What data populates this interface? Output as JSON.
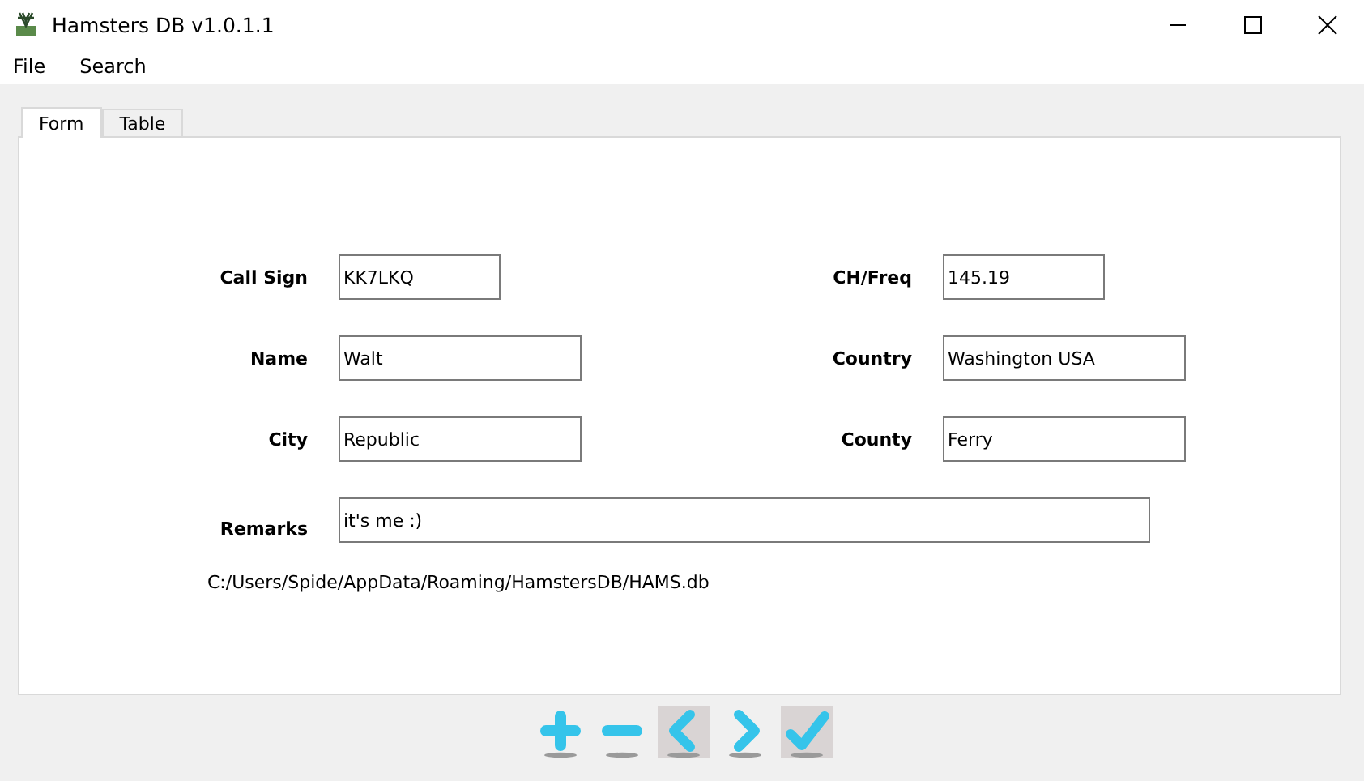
{
  "window": {
    "title": "Hamsters DB v1.0.1.1"
  },
  "menu": [
    "File",
    "Search"
  ],
  "tabs": [
    {
      "label": "Form",
      "selected": true
    },
    {
      "label": "Table",
      "selected": false
    }
  ],
  "fields": [
    {
      "label": "Call Sign",
      "value": "KK7LKQ",
      "kind": "short"
    },
    {
      "label": "CH/Freq",
      "value": "145.19",
      "kind": "short"
    },
    {
      "label": "Name",
      "value": "Walt",
      "kind": "normal"
    },
    {
      "label": "Country",
      "value": "Washington USA",
      "kind": "normal"
    },
    {
      "label": "City",
      "value": "Republic",
      "kind": "normal"
    },
    {
      "label": "County",
      "value": "Ferry",
      "kind": "normal"
    },
    {
      "label": "Remarks",
      "value": "it's me :)",
      "kind": "wide"
    }
  ],
  "db_path": "C:/Users/Spide/AppData/Roaming/HamstersDB/HAMS.db",
  "toolbar": [
    {
      "kind": "add",
      "highlighted": false
    },
    {
      "kind": "remove",
      "highlighted": false
    },
    {
      "kind": "previous",
      "highlighted": true
    },
    {
      "kind": "next",
      "highlighted": false
    },
    {
      "kind": "confirm",
      "highlighted": true
    }
  ]
}
